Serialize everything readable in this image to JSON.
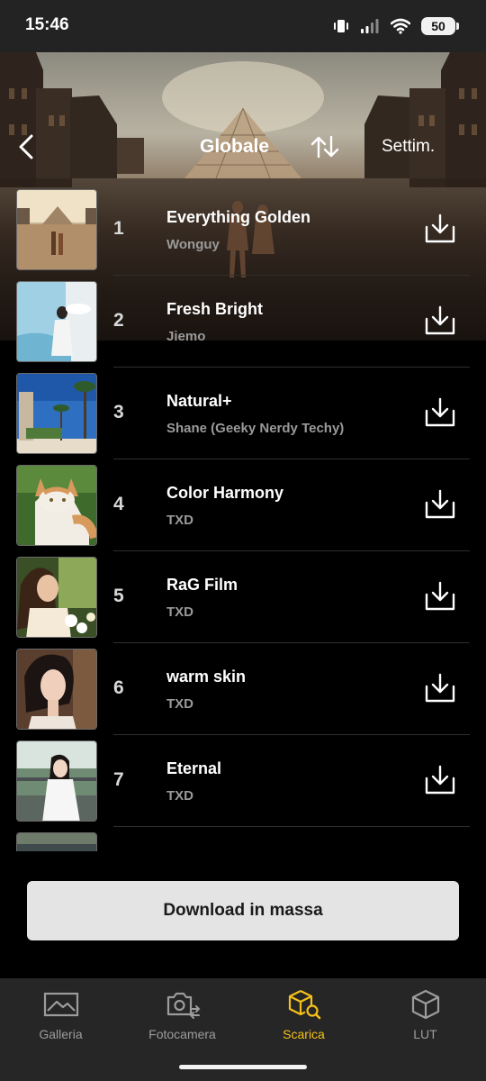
{
  "status_bar": {
    "time": "15:46",
    "battery": "50"
  },
  "header": {
    "title": "Globale",
    "period": "Settim."
  },
  "presets": [
    {
      "rank": "1",
      "name": "Everything Golden",
      "author": "Wonguy"
    },
    {
      "rank": "2",
      "name": "Fresh Bright",
      "author": "Jiemo"
    },
    {
      "rank": "3",
      "name": "Natural+",
      "author": "Shane (Geeky Nerdy Techy)"
    },
    {
      "rank": "4",
      "name": "Color Harmony",
      "author": "TXD"
    },
    {
      "rank": "5",
      "name": "RaG Film",
      "author": "TXD"
    },
    {
      "rank": "6",
      "name": "warm skin",
      "author": "TXD"
    },
    {
      "rank": "7",
      "name": "Eternal",
      "author": "TXD"
    }
  ],
  "bulk_download": {
    "label": "Download in massa"
  },
  "tabbar": {
    "tabs": [
      {
        "label": "Galleria",
        "icon": "gallery-icon",
        "active": false
      },
      {
        "label": "Fotocamera",
        "icon": "camera-switch-icon",
        "active": false
      },
      {
        "label": "Scarica",
        "icon": "cube-search-icon",
        "active": true
      },
      {
        "label": "LUT",
        "icon": "cube-icon",
        "active": false
      }
    ]
  },
  "colors": {
    "accent": "#f4c21a",
    "background": "#000000",
    "tabbar": "#262626",
    "button": "#e4e4e4"
  }
}
